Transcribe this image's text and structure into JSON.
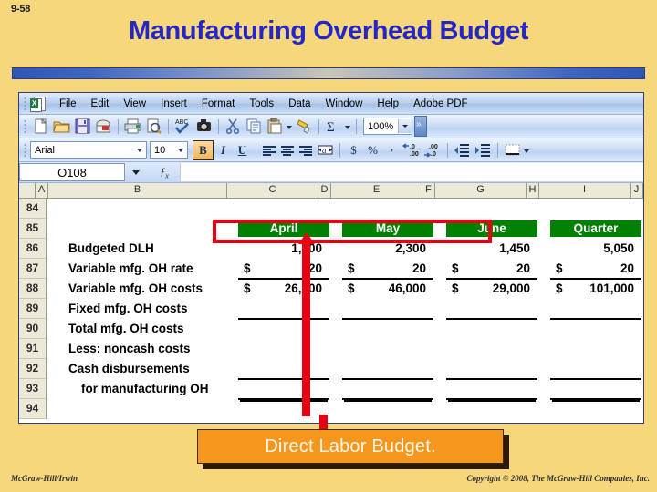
{
  "slide": {
    "number": "9-58",
    "title": "Manufacturing Overhead Budget",
    "footer_left": "McGraw-Hill/Irwin",
    "footer_right": "Copyright © 2008, The McGraw-Hill Companies, Inc."
  },
  "callout": {
    "label": "Direct Labor Budget."
  },
  "excel": {
    "menus": [
      "File",
      "Edit",
      "View",
      "Insert",
      "Format",
      "Tools",
      "Data",
      "Window",
      "Help",
      "Adobe PDF"
    ],
    "standard_toolbar": [
      "new-icon",
      "open-icon",
      "save-icon",
      "email-icon",
      "print-icon",
      "print-preview-icon",
      "spelling-icon",
      "research-icon",
      "cut-icon",
      "copy-icon",
      "paste-icon",
      "format-painter-icon",
      "autosum-icon"
    ],
    "zoom": "100%",
    "font_name": "Arial",
    "font_size": "10",
    "bold_label": "B",
    "italic_label": "I",
    "underline_label": "U",
    "format_buttons": [
      "align-left-icon",
      "align-center-icon",
      "align-right-icon",
      "merge-center-icon",
      "currency-icon",
      "percent-icon",
      "comma-icon",
      "increase-decimal-icon",
      "decrease-decimal-icon",
      "decrease-indent-icon",
      "increase-indent-icon",
      "borders-icon"
    ],
    "name_box": "O108",
    "formula_value": "",
    "columns": [
      "A",
      "B",
      "C",
      "D",
      "E",
      "F",
      "G",
      "H",
      "I",
      "J"
    ],
    "rows": [
      "84",
      "85",
      "86",
      "87",
      "88",
      "89",
      "90",
      "91",
      "92",
      "93",
      "94"
    ],
    "period_headers": [
      "April",
      "May",
      "June",
      "Quarter"
    ],
    "header_color": "#008000",
    "highlight_color": "#e60012",
    "table": [
      {
        "row": "84",
        "label": "",
        "values": [
          "",
          "",
          "",
          ""
        ],
        "dollars": [
          false,
          false,
          false,
          false
        ],
        "rule": "none"
      },
      {
        "row": "85",
        "label": "",
        "values": [
          "April",
          "May",
          "June",
          "Quarter"
        ],
        "dollars": [
          false,
          false,
          false,
          false
        ],
        "rule": "header"
      },
      {
        "row": "86",
        "label": "Budgeted DLH",
        "values": [
          "1,300",
          "2,300",
          "1,450",
          "5,050"
        ],
        "dollars": [
          false,
          false,
          false,
          false
        ],
        "rule": "none"
      },
      {
        "row": "87",
        "label": "Variable mfg. OH rate",
        "values": [
          "20",
          "20",
          "20",
          "20"
        ],
        "dollars": [
          true,
          true,
          true,
          true
        ],
        "rule": "single"
      },
      {
        "row": "88",
        "label": "Variable mfg. OH costs",
        "values": [
          "26,000",
          "46,000",
          "29,000",
          "101,000"
        ],
        "dollars": [
          true,
          true,
          true,
          true
        ],
        "rule": "none"
      },
      {
        "row": "89",
        "label": "Fixed mfg. OH costs",
        "values": [
          "",
          "",
          "",
          ""
        ],
        "dollars": [
          false,
          false,
          false,
          false
        ],
        "rule": "single"
      },
      {
        "row": "90",
        "label": "Total mfg. OH costs",
        "values": [
          "",
          "",
          "",
          ""
        ],
        "dollars": [
          false,
          false,
          false,
          false
        ],
        "rule": "none"
      },
      {
        "row": "91",
        "label": "Less: noncash costs",
        "values": [
          "",
          "",
          "",
          ""
        ],
        "dollars": [
          false,
          false,
          false,
          false
        ],
        "rule": "none"
      },
      {
        "row": "92",
        "label": "Cash disbursements",
        "values": [
          "",
          "",
          "",
          ""
        ],
        "dollars": [
          false,
          false,
          false,
          false
        ],
        "rule": "single"
      },
      {
        "row": "93",
        "label": "for manufacturing OH",
        "indent": true,
        "values": [
          "",
          "",
          "",
          ""
        ],
        "dollars": [
          false,
          false,
          false,
          false
        ],
        "rule": "double"
      },
      {
        "row": "94",
        "label": "",
        "values": [
          "",
          "",
          "",
          ""
        ],
        "dollars": [
          false,
          false,
          false,
          false
        ],
        "rule": "none"
      }
    ]
  }
}
